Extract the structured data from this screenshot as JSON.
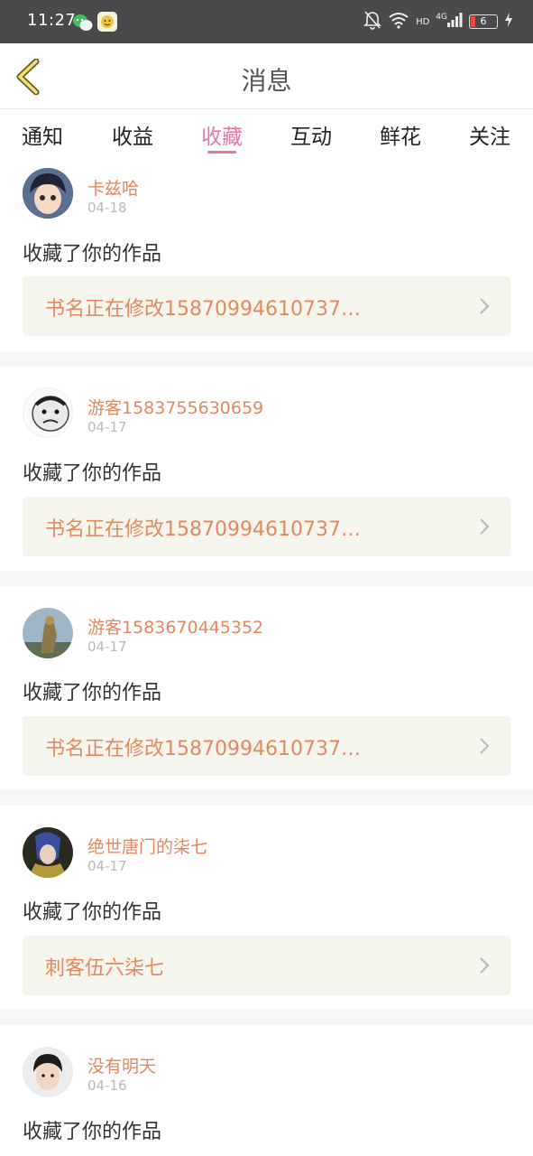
{
  "status_bar": {
    "time": "11:27",
    "battery": "6",
    "network": "4G",
    "hd": "HD"
  },
  "header": {
    "title": "消息"
  },
  "tabs": [
    "通知",
    "收益",
    "收藏",
    "互动",
    "鲜花",
    "关注"
  ],
  "active_tab": "收藏",
  "messages": [
    {
      "name": "卡兹哈",
      "date": "04-18",
      "action": "收藏了你的作品",
      "book": "书名正在修改15870994610737…"
    },
    {
      "name": "游客1583755630659",
      "date": "04-17",
      "action": "收藏了你的作品",
      "book": "书名正在修改15870994610737…"
    },
    {
      "name": "游客1583670445352",
      "date": "04-17",
      "action": "收藏了你的作品",
      "book": "书名正在修改15870994610737…"
    },
    {
      "name": "绝世唐门的柒七",
      "date": "04-17",
      "action": "收藏了你的作品",
      "book": "刺客伍六柒七"
    },
    {
      "name": "没有明天",
      "date": "04-16",
      "action": "收藏了你的作品"
    }
  ],
  "colors": {
    "accent_pink": "#e27aa8",
    "name_orange": "#e2895e",
    "status_bar": "#4a4a4a",
    "book_box": "#f5f5ee"
  }
}
